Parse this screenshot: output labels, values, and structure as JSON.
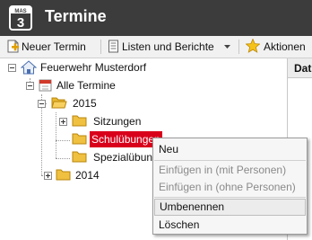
{
  "window": {
    "app_icon_text": "MAS",
    "app_icon_digit": "3",
    "title": "Termine"
  },
  "toolbar": {
    "new_label": "Neuer Termin",
    "lists_label": "Listen und Berichte",
    "actions_label": "Aktionen"
  },
  "grid": {
    "column_header": "Datum"
  },
  "tree": {
    "root": "Feuerwehr Musterdorf",
    "all": "Alle Termine",
    "year_2015": "2015",
    "sitzungen": "Sitzungen",
    "schuluebungen": "Schulübungen",
    "spezialuebungen": "Spezialübungen",
    "year_2014": "2014"
  },
  "context_menu": {
    "items": [
      {
        "label": "Neu",
        "enabled": true
      },
      {
        "label": "Einfügen in (mit Personen)",
        "enabled": false
      },
      {
        "label": "Einfügen in (ohne Personen)",
        "enabled": false
      },
      {
        "label": "Umbenennen",
        "enabled": true,
        "hovered": true
      },
      {
        "label": "Löschen",
        "enabled": true
      }
    ]
  },
  "colors": {
    "titlebar": "#3c3c3c",
    "selection": "#d9001b",
    "folder": "#f0c040"
  }
}
